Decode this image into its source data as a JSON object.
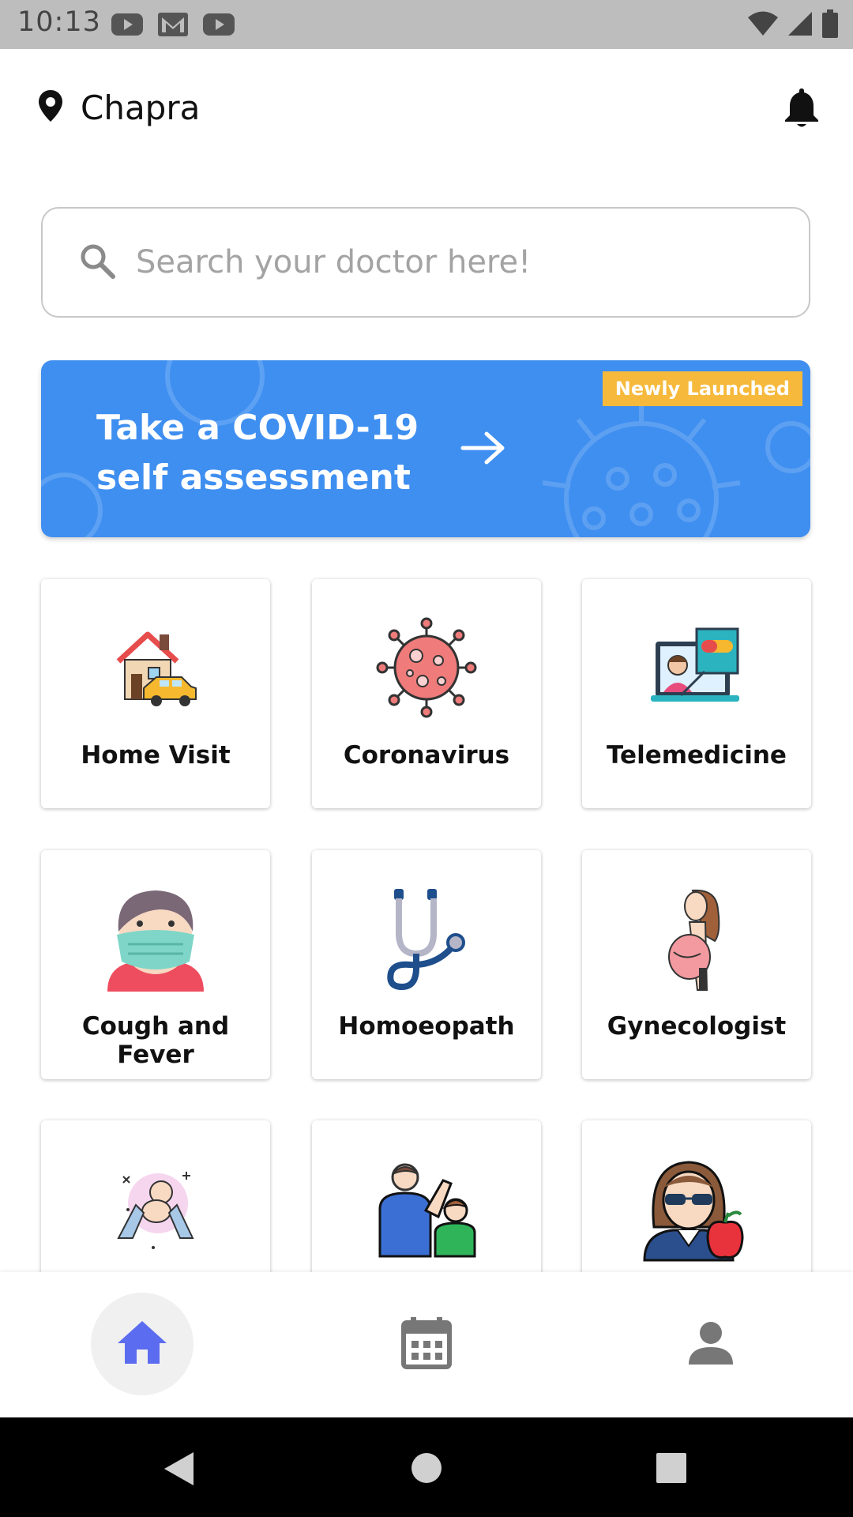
{
  "status_bar": {
    "time": "10:13",
    "notification_icons": [
      "youtube-icon",
      "gmail-icon",
      "youtube-icon"
    ],
    "system_icons": [
      "wifi-icon",
      "signal-icon",
      "battery-icon"
    ]
  },
  "header": {
    "location": "Chapra",
    "location_icon": "map-pin-icon",
    "notification_icon": "bell-icon"
  },
  "search": {
    "placeholder": "Search your doctor here!",
    "value": ""
  },
  "banner": {
    "title_line1": "Take a COVID-19",
    "title_line2": "self assessment",
    "tag": "Newly Launched",
    "background_color": "#3f8ff0",
    "tag_color": "#f6b93b"
  },
  "categories": [
    {
      "label": "Home Visit",
      "icon": "house-car-icon"
    },
    {
      "label": "Coronavirus",
      "icon": "virus-icon"
    },
    {
      "label": "Telemedicine",
      "icon": "telemedicine-icon"
    },
    {
      "label": "Cough and Fever",
      "icon": "masked-person-icon"
    },
    {
      "label": "Homoeopath",
      "icon": "stethoscope-icon"
    },
    {
      "label": "Gynecologist",
      "icon": "pregnant-woman-icon"
    },
    {
      "label": "",
      "icon": "baby-hands-icon"
    },
    {
      "label": "",
      "icon": "doctor-child-icon"
    },
    {
      "label": "",
      "icon": "nutritionist-apple-icon"
    }
  ],
  "bottom_nav": [
    {
      "name": "home",
      "icon": "home-icon",
      "active": true
    },
    {
      "name": "appointments",
      "icon": "calendar-icon",
      "active": false
    },
    {
      "name": "profile",
      "icon": "person-icon",
      "active": false
    }
  ],
  "accent_color": "#5b6cf0"
}
